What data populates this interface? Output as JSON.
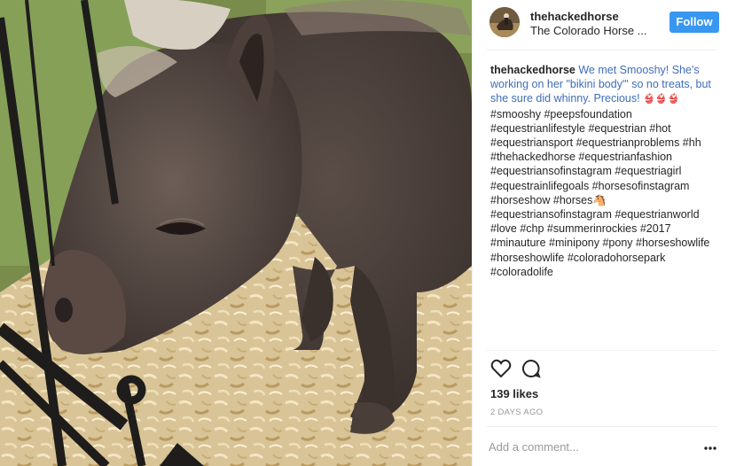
{
  "post": {
    "photo_alt": "",
    "header": {
      "username": "thehackedhorse",
      "location": "The Colorado Horse ...",
      "follow_label": "Follow",
      "avatar_icon": "avatar-photo"
    },
    "caption": {
      "username": "thehackedhorse",
      "text_blue": "We met Smooshy! She's working on her \"bikini body\"' so no treats, but she sure did whinny. Precious!",
      "emoji": "👙👙👙",
      "hashtags": "#smooshy #peepsfoundation #equestrianlifestyle #equestrian #hot #equestriansport #equestrianproblems #hh #thehackedhorse #equestrianfashion #equestriansofinstagram #equestriagirl #equestrainlifegoals #horsesofinstagram #horseshow #horses🐴 #equestriansofinstagram #equestrianworld #love #chp #summerinrockies #2017 #minauture #minipony #pony #horseshowlife #horseshowlife #coloradohorsepark #coloradolife"
    },
    "actions": {
      "like_icon": "heart-outline-icon",
      "comment_icon": "speech-bubble-icon"
    },
    "likes": "139 likes",
    "timestamp": "2 DAYS AGO",
    "comment": {
      "placeholder": "Add a comment...",
      "value": ""
    },
    "more_icon": "more-options-icon",
    "colors": {
      "follow_button": "#3897f0",
      "caption_link": "#3f6dba",
      "muted": "#999999",
      "divider": "#efefef"
    }
  }
}
